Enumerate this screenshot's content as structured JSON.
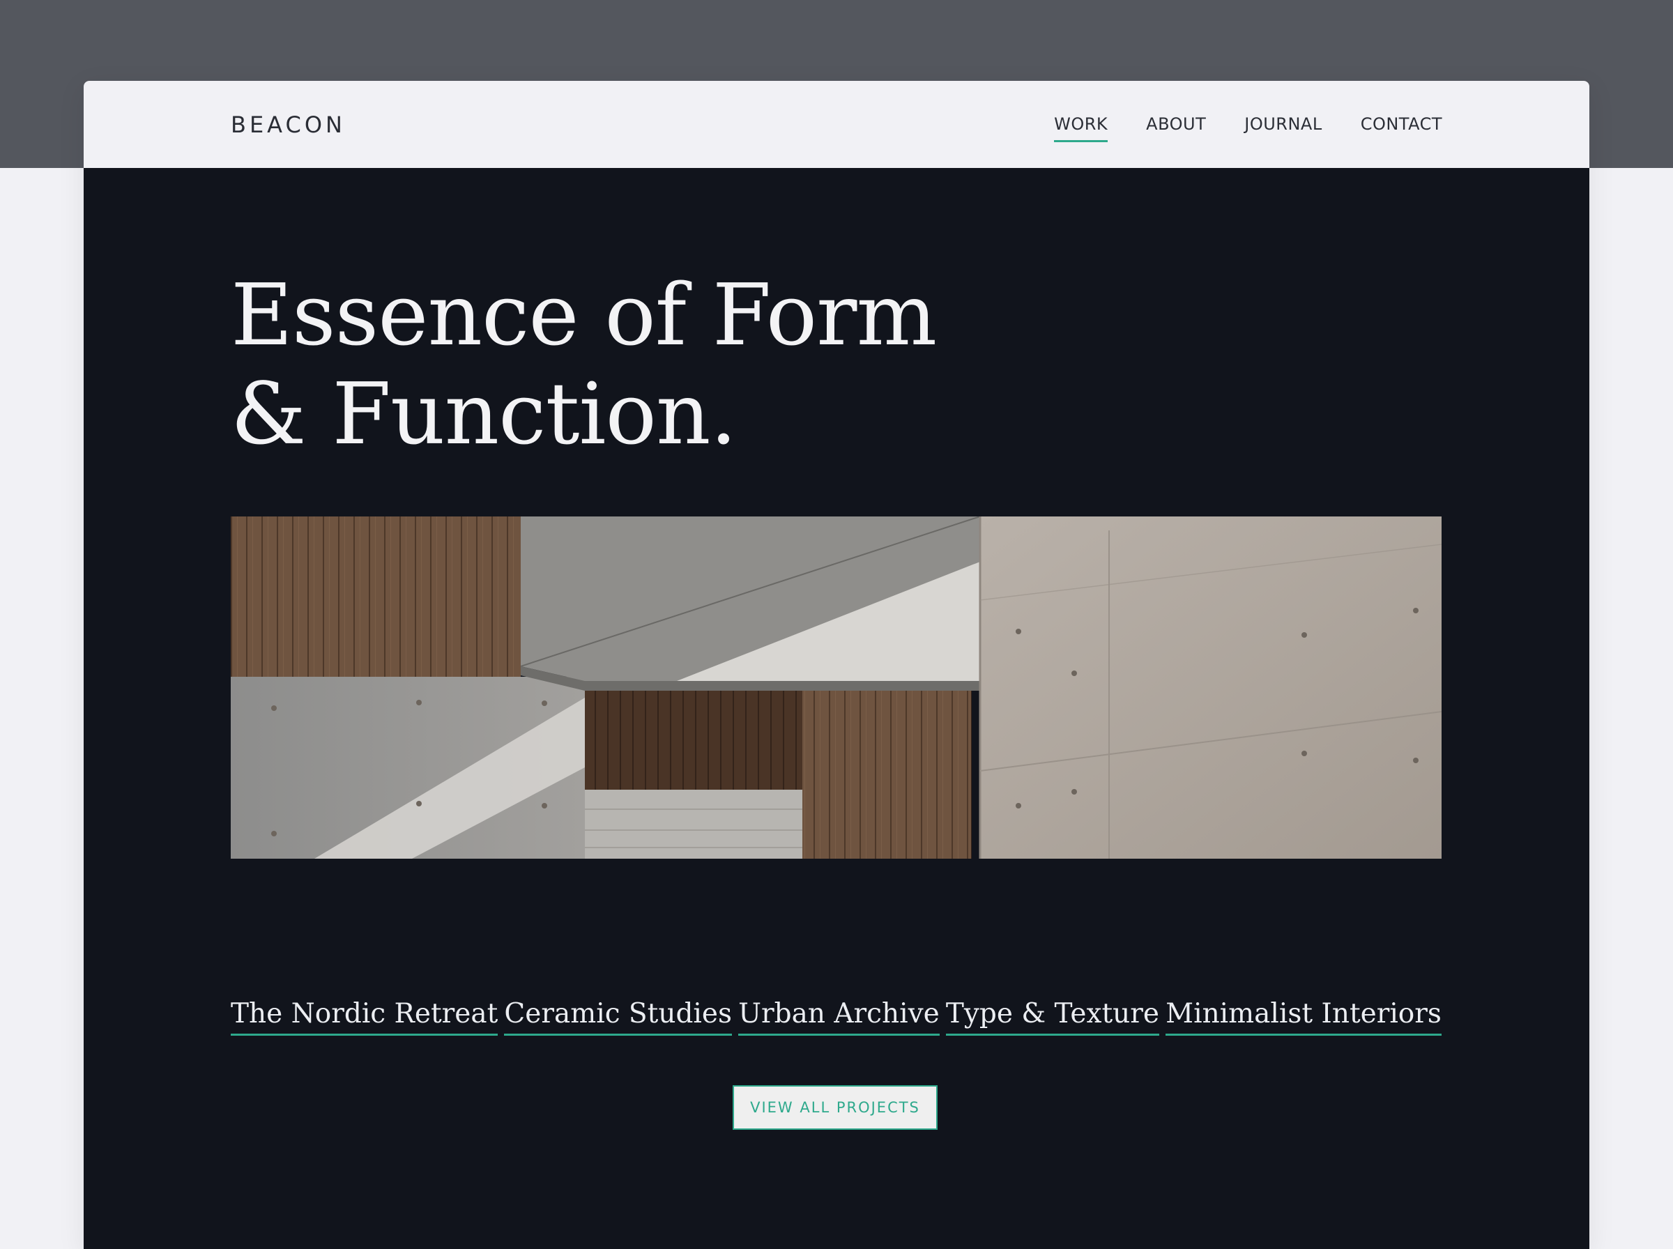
{
  "brand": {
    "name": "BEACON"
  },
  "nav": {
    "items": [
      {
        "label": "WORK",
        "active": true
      },
      {
        "label": "ABOUT",
        "active": false
      },
      {
        "label": "JOURNAL",
        "active": false
      },
      {
        "label": "CONTACT",
        "active": false
      }
    ]
  },
  "hero": {
    "headline_line1": "Essence of Form",
    "headline_line2": "& Function."
  },
  "projects": [
    "The Nordic Retreat",
    "Ceramic Studies",
    "Urban Archive",
    "Type & Texture",
    "Minimalist Interiors"
  ],
  "cta": {
    "label": "VIEW ALL PROJECTS"
  },
  "colors": {
    "accent": "#2ea98c",
    "page_background": "#11141c",
    "nav_background": "#f1f1f5",
    "top_band": "#54575e"
  }
}
